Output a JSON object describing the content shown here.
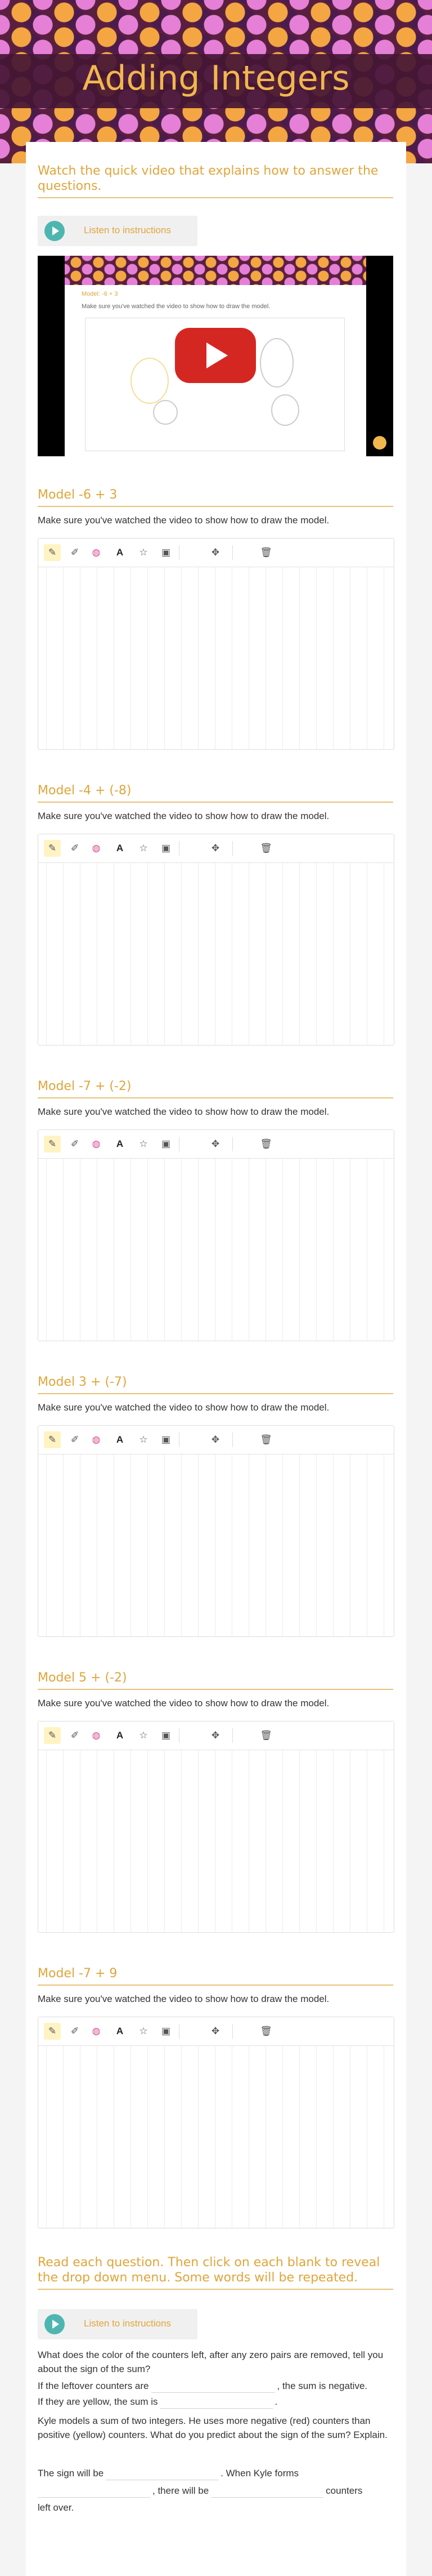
{
  "page": {
    "title": "Adding Integers"
  },
  "video_section": {
    "heading": "Watch the quick video that explains how to answer the questions.",
    "listen_label": "Listen to instructions",
    "video_model_text": "Model: -6 + 3",
    "video_instruction_text": "Make sure you've watched the video to show how to draw the model."
  },
  "models": [
    {
      "heading": "Model -6 + 3",
      "instruction": "Make sure you've watched the video to show how to draw the model."
    },
    {
      "heading": "Model -4 + (-8)",
      "instruction": "Make sure you've watched the video to show how to draw the model."
    },
    {
      "heading": "Model -7 + (-2)",
      "instruction": "Make sure you've watched the video to show how to draw the model."
    },
    {
      "heading": "Model 3 + (-7)",
      "instruction": "Make sure you've watched the video to show how to draw the model."
    },
    {
      "heading": "Model 5 + (-2)",
      "instruction": "Make sure you've watched the video to show how to draw the model."
    },
    {
      "heading": "Model -7 + 9",
      "instruction": "Make sure you've watched the video to show how to draw the model."
    }
  ],
  "toolbar": {
    "pencil_icon": "pencil-icon",
    "highlighter_icon": "highlighter-icon",
    "color_icon": "color-wheel-icon",
    "text_icon": "A",
    "star_icon": "☆",
    "image_icon": "image-icon",
    "move_icon": "move-icon",
    "trash_icon": "trash-icon",
    "active_color": "#fff3c4"
  },
  "questions_section": {
    "heading": "Read each question. Then click on each blank to reveal the drop down menu. Some words will be repeated.",
    "listen_label": "Listen to instructions",
    "q1": "What does the color of the counters left, after any zero pairs are removed, tell you about the sign of the sum?",
    "q1_line1_a": "If the leftover counters are",
    "q1_line1_b": ", the sum is negative.",
    "q1_line2_a": "If they are yellow, the sum is",
    "q1_line2_b": ".",
    "q2": "Kyle models a sum of two integers. He uses more negative (red) counters than positive (yellow) counters. What do you predict about the sign of the sum? Explain.",
    "q2_line_a": "The sign will be",
    "q2_line_b": ". When Kyle forms",
    "q2_line_c": ", there will be",
    "q2_line_d": "counters",
    "q2_line_e": "left over."
  },
  "colors": {
    "accent": "#e0a53c",
    "title": "#f1b74e",
    "teal": "#4eb6b0"
  }
}
